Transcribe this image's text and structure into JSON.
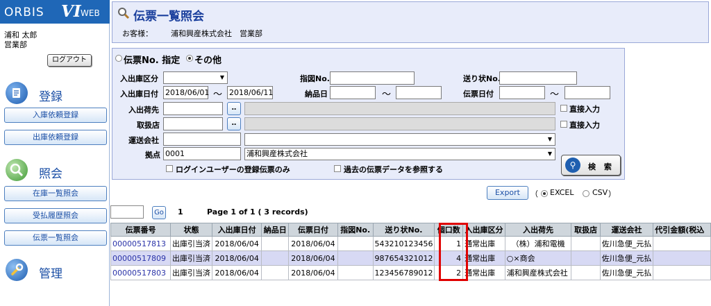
{
  "brand": {
    "orbis": "ORBIS",
    "vi": "VI",
    "web": "WEB"
  },
  "user": {
    "name": "浦和 太郎",
    "dept": "営業部",
    "logout_label": "ログアウト"
  },
  "sidebar": {
    "sections": [
      {
        "label": "登録",
        "items": [
          "入庫依頼登録",
          "出庫依頼登録"
        ]
      },
      {
        "label": "照会",
        "items": [
          "在庫一覧照会",
          "受払履歴照会",
          "伝票一覧照会"
        ]
      },
      {
        "label": "管理",
        "items": []
      }
    ]
  },
  "header": {
    "title": "伝票一覧照会",
    "customer_label": "お客様：",
    "customer_value": "浦和興産株式会社　営業部"
  },
  "search": {
    "mode_options": [
      "伝票No. 指定",
      "その他"
    ],
    "mode_selected": "その他",
    "fields": {
      "inout_type_label": "入出庫区分",
      "inout_type_value": "",
      "instruction_no_label": "指図No.",
      "instruction_no_value": "",
      "tracking_no_label": "送り状No.",
      "tracking_no_value": "",
      "inout_date_label": "入出庫日付",
      "inout_date_from": "2018/06/01",
      "inout_date_to": "2018/06/11",
      "range_sep": "～",
      "delivery_date_label": "納品日",
      "delivery_date_from": "",
      "delivery_date_to": "",
      "slip_date_label": "伝票日付",
      "slip_date_from": "",
      "slip_date_to": "",
      "consignee_label": "入出荷先",
      "consignee_code": "",
      "consignee_name": "",
      "dealer_label": "取扱店",
      "dealer_code": "",
      "dealer_name": "",
      "direct_input_label": "直接入力",
      "carrier_label": "運送会社",
      "carrier_code": "",
      "carrier_name": "",
      "base_label": "拠点",
      "base_code": "0001",
      "base_name": "浦和興産株式会社",
      "dots_label": "‥",
      "login_user_only_label": "ログインユーザーの登録伝票のみ",
      "past_data_label": "過去の伝票データを参照する"
    },
    "search_button": "検 索"
  },
  "export": {
    "button": "Export",
    "open_paren": "（",
    "close_paren": "）",
    "options": [
      "EXCEL",
      "CSV"
    ],
    "selected": "EXCEL"
  },
  "paging": {
    "go_label": "Go",
    "page_no": "1",
    "summary": "Page 1 of 1 ( 3 records)"
  },
  "table": {
    "headers": [
      "伝票番号",
      "状態",
      "入出庫日付",
      "納品日",
      "伝票日付",
      "指図No.",
      "送り状No.",
      "個口数",
      "入出庫区分",
      "入出荷先",
      "取扱店",
      "運送会社",
      "代引金額(税込"
    ],
    "rows": [
      [
        "00000517813",
        "出庫引当済",
        "2018/06/04",
        "",
        "2018/06/04",
        "",
        "543210123456",
        "1",
        "通常出庫",
        "（株）浦和電機",
        "",
        "佐川急便_元払",
        ""
      ],
      [
        "00000517809",
        "出庫引当済",
        "2018/06/04",
        "",
        "2018/06/04",
        "",
        "987654321012",
        "4",
        "通常出庫",
        "○×商会",
        "",
        "佐川急便_元払",
        ""
      ],
      [
        "00000517803",
        "出庫引当済",
        "2018/06/04",
        "",
        "2018/06/04",
        "",
        "123456789012",
        "2",
        "通常出庫",
        "浦和興産株式会社",
        "",
        "佐川急便_元払",
        ""
      ]
    ],
    "highlight_column": "個口数"
  },
  "colors": {
    "brand_blue": "#1f67b7",
    "panel_bg": "#e8ecfa",
    "highlight_red": "#e00000",
    "link": "#2a33a8"
  }
}
